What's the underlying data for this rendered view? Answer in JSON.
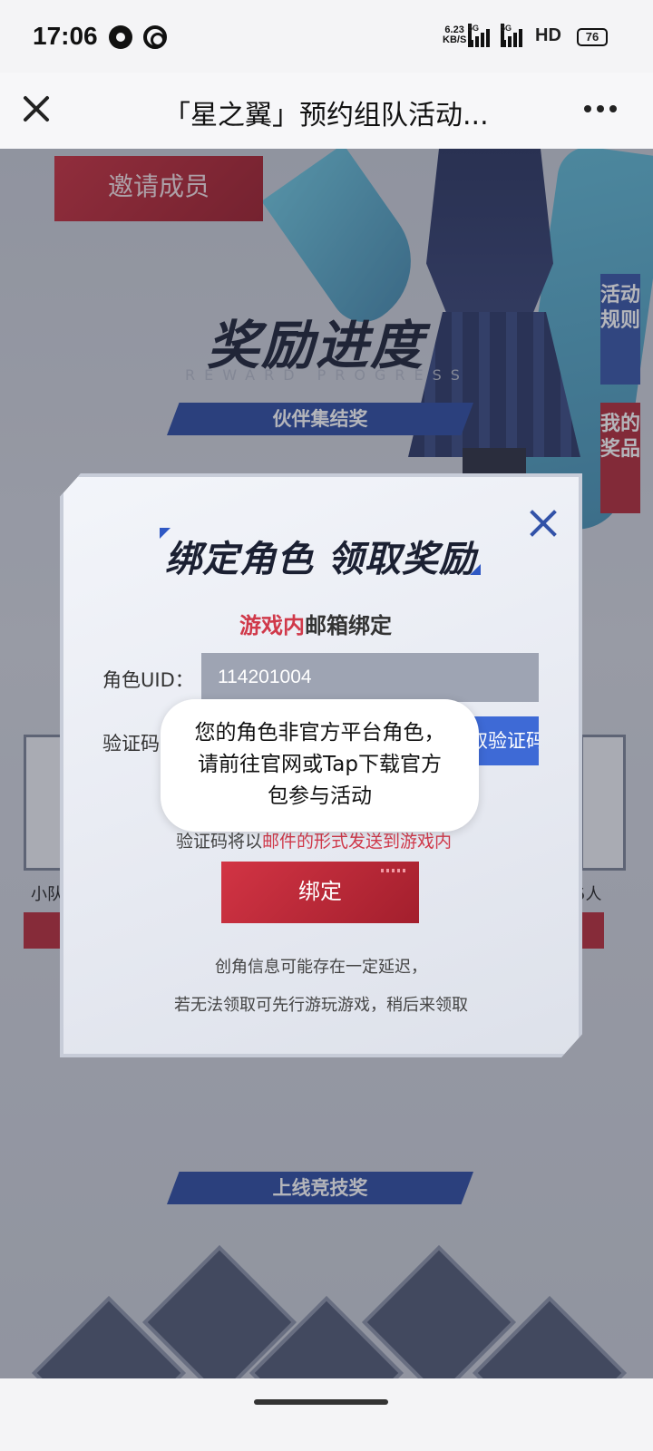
{
  "status_bar": {
    "time": "17:06",
    "net_speed_value": "6.23",
    "net_speed_unit": "KB/S",
    "signal_tag": "5G",
    "hd_label": "HD",
    "battery": "76"
  },
  "header": {
    "title": "「星之翼」预约组队活动..."
  },
  "background": {
    "invite_label": "邀请成员",
    "reward_title": "奖励进度",
    "reward_subtitle": "REWARD PROGRESS",
    "section1": "伙伴集结奖",
    "section2": "上线竞技奖",
    "side_tab_rules": "活动规则",
    "side_tab_prizes": "我的奖品",
    "left_peek_label": "小队",
    "right_peek_label": "5人"
  },
  "modal": {
    "title": "绑定角色  领取奖励",
    "subtitle_red": "游戏内",
    "subtitle_rest": "邮箱绑定",
    "uid_label": "角色UID：",
    "uid_value": "114201004",
    "code_label": "验证码",
    "get_code_label": "获取验证码",
    "hint_prefix": "验证码将以",
    "hint_red": "邮件的形式发送到游戏内",
    "bind_label": "绑定",
    "note_line1": "创角信息可能存在一定延迟，",
    "note_line2": "若无法领取可先行游玩游戏，稍后来领取"
  },
  "toast": {
    "line1": "您的角色非官方平台角色，",
    "line2": "请前往官网或Tap下载官方",
    "line3": "包参与活动"
  },
  "colors": {
    "accent_red": "#c92f3e",
    "accent_blue": "#3e6ad6",
    "text_red": "#d0394a"
  }
}
